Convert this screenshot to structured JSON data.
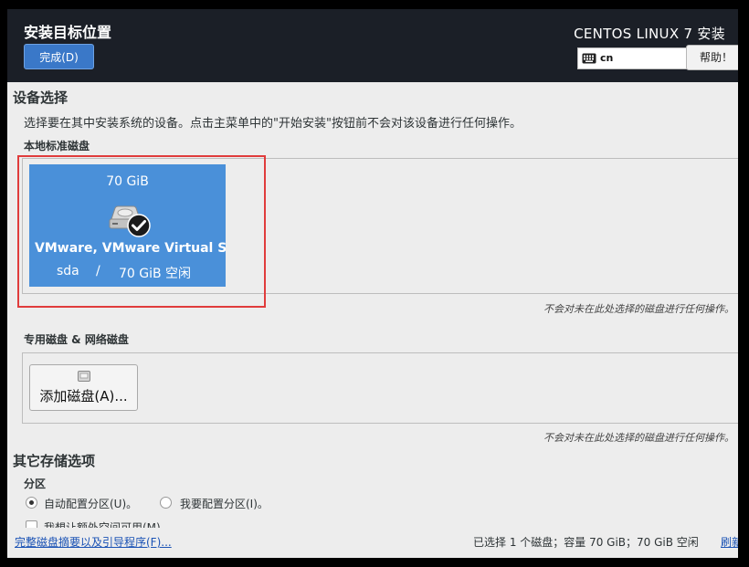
{
  "header": {
    "title": "安装目标位置",
    "done_label": "完成(D)",
    "product": "CENTOS LINUX 7 安装",
    "keyboard_layout": "cn",
    "help_label": "帮助！"
  },
  "device_selection": {
    "heading": "设备选择",
    "description": "选择要在其中安装系统的设备。点击主菜单中的\"开始安装\"按钮前不会对该设备进行任何操作。",
    "local_disks": {
      "heading": "本地标准磁盘",
      "disks": [
        {
          "size": "70 GiB",
          "name": "VMware, VMware Virtual S",
          "device": "sda",
          "separator": "/",
          "free": "70 GiB 空闲",
          "selected": true
        }
      ],
      "note": "不会对未在此处选择的磁盘进行任何操作。"
    },
    "special_disks": {
      "heading": "专用磁盘 & 网络磁盘",
      "add_label": "添加磁盘(A)...",
      "note": "不会对未在此处选择的磁盘进行任何操作。"
    }
  },
  "other_storage": {
    "heading": "其它存储选项",
    "partition_heading": "分区",
    "auto_label": "自动配置分区(U)。",
    "manual_label": "我要配置分区(I)。",
    "extra_label": "我想让额外空间可用(M)",
    "selected": "auto"
  },
  "footer": {
    "summary_link": "完整磁盘摘要以及引导程序(F)...",
    "status": "已选择 1 个磁盘；容量 70 GiB；70 GiB 空闲",
    "refresh_link": "刷新(R)"
  },
  "icons": [
    "keyboard-icon",
    "hard-disk-icon",
    "checkmark-icon",
    "add-disk-icon"
  ],
  "colors": {
    "header_bg": "#1b1f27",
    "accent": "#4a90d9",
    "link": "#1a52b5",
    "highlight_box": "#e03c3c"
  }
}
